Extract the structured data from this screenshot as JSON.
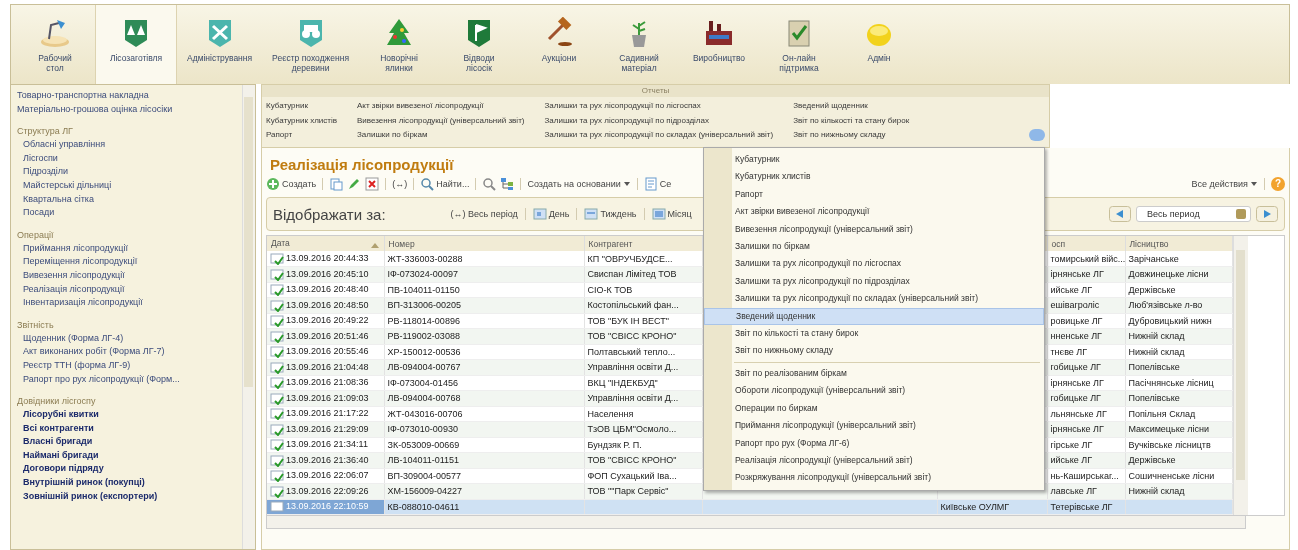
{
  "toolbar": {
    "items": [
      {
        "label": "Рабочий\nстол",
        "selected": false
      },
      {
        "label": "Лісозаготівля",
        "selected": true
      },
      {
        "label": "Адміністрування",
        "selected": false
      },
      {
        "label": "Реєстр походження\nдеревини",
        "selected": false
      },
      {
        "label": "Новорічні\nялинки",
        "selected": false
      },
      {
        "label": "Відводи\nлісосік",
        "selected": false
      },
      {
        "label": "Аукціони",
        "selected": false
      },
      {
        "label": "Садивний\nматеріал",
        "selected": false
      },
      {
        "label": "Виробництво",
        "selected": false
      },
      {
        "label": "Он-лайн\nпідтримка",
        "selected": false
      },
      {
        "label": "Адмін",
        "selected": false
      }
    ]
  },
  "sidebar": {
    "sections": [
      {
        "kind": "links",
        "items": [
          "Товарно-транспортна накладна",
          "Матеріально-грошова оцінка лісосіки"
        ]
      },
      {
        "kind": "links",
        "heading": "Структура ЛГ",
        "items": [
          "Обласні управління",
          "Лісгоспи",
          "Підрозділи",
          "Майстерські дільниці",
          "Квартальна сітка",
          "Посади"
        ]
      },
      {
        "kind": "links",
        "heading": "Операції",
        "items": [
          "Приймання лісопродукції",
          "Переміщення лісопродукції",
          "Вивезення лісопродукції",
          "Реалізація лісопродукції",
          "Інвентаризація лісопродукції"
        ]
      },
      {
        "kind": "links",
        "heading": "Звітність",
        "items": [
          "Щоденник (Форма ЛГ-4)",
          "Акт виконаних робіт (Форма ЛГ-7)",
          "Реєстр ТТН (форма ЛГ-9)",
          "Рапорт про рух лісопродукції (Форм..."
        ]
      },
      {
        "kind": "catalogs",
        "heading": "Довідники лісгоспу",
        "items": [
          "Лісорубні квитки",
          "Всі контрагенти",
          "Власні бригади",
          "Наймані бригади",
          "Договори підряду",
          "Внутрішній ринок (покупці)",
          "Зовнішній ринок (експортери)"
        ]
      }
    ]
  },
  "reports_panel": {
    "title": "Отчеты",
    "menu_open": true,
    "columns": [
      [
        "Кубатурник",
        "Кубатурник хлистів",
        "Рапорт"
      ],
      [
        "Акт звірки вивезеної лісопродукції",
        "Вивезення лісопродукції (універсальний звіт)",
        "Залишки по біркам"
      ],
      [
        "Залишки та рух лісопродукції по лісгоспах",
        "Залишки та рух лісопродукції по підрозділах",
        "Залишки та рух лісопродукції по складах (універсальний звіт)"
      ],
      [
        "Зведений щоденник",
        "Звіт по кількості та стану бирок",
        "Звіт по нижньому складу"
      ]
    ]
  },
  "document": {
    "title": "Реалізація лісопродукції",
    "commands": [
      [
        {
          "kind": "button",
          "label": "Создать"
        }
      ],
      [
        {
          "kind": "icon"
        },
        {
          "kind": "icon"
        },
        {
          "kind": "icon"
        }
      ],
      [
        {
          "kind": "button",
          "label": "(↔)"
        }
      ],
      [
        {
          "kind": "button",
          "label": "Найти..."
        }
      ],
      [
        {
          "kind": "icon"
        },
        {
          "kind": "icon"
        }
      ],
      [
        {
          "kind": "menu",
          "label": "Создать на основании"
        }
      ],
      [
        {
          "kind": "button",
          "label": "Се"
        }
      ]
    ],
    "all_actions": "Все действия",
    "help": "?"
  },
  "period_filter": {
    "label": "Відображати за:",
    "options": [
      {
        "label": "(↔) Весь період"
      },
      {
        "label": "День"
      },
      {
        "label": "Тиждень"
      },
      {
        "label": "Місяц"
      }
    ],
    "period_field": "Весь период"
  },
  "table": {
    "columns": [
      {
        "label": "Дата",
        "sorted": true
      },
      {
        "label": "Номер",
        "sorted": false
      },
      {
        "label": "Контрагент",
        "sorted": false
      },
      {},
      {},
      {
        "label": "осп",
        "sorted": false
      },
      {
        "label": "Лісництво",
        "sorted": false
      }
    ],
    "rows": [
      {
        "posted": true,
        "selected": false,
        "date": "13.09.2016 20:44:33",
        "number": "ЖТ-336003-00288",
        "counterparty": "КП \"ОВРУЧБУДСЕ...",
        "column_6": "томирський війс...",
        "forest_district": "Зарічанське"
      },
      {
        "posted": true,
        "selected": false,
        "date": "13.09.2016 20:45:10",
        "number": "ІФ-073024-00097",
        "counterparty": "Свиспан Лімітед ТОВ",
        "column_6": "ірнянське ЛГ",
        "forest_district": "Довжинецьке лісни"
      },
      {
        "posted": true,
        "selected": false,
        "date": "13.09.2016 20:48:40",
        "number": "ПВ-104011-01150",
        "counterparty": "СІО-К ТОВ",
        "column_6": "ийське ЛГ",
        "forest_district": "Держівське"
      },
      {
        "posted": true,
        "selected": false,
        "date": "13.09.2016 20:48:50",
        "number": "ВП-313006-00205",
        "counterparty": "Костопільський фан...",
        "column_6": "ешівагроліс",
        "forest_district": "Люб'язівське л-во"
      },
      {
        "posted": true,
        "selected": false,
        "date": "13.09.2016 20:49:22",
        "number": "РВ-118014-00896",
        "counterparty": "ТОВ \"БУК ІН ВЕСТ\"",
        "column_6": "ровицьке ЛГ",
        "forest_district": "Дубровицький нижн"
      },
      {
        "posted": true,
        "selected": false,
        "date": "13.09.2016 20:51:46",
        "number": "РВ-119002-03088",
        "counterparty": "ТОВ \"СВІСС КРОНО\"",
        "column_6": "нненське ЛГ",
        "forest_district": "Нижній склад"
      },
      {
        "posted": true,
        "selected": false,
        "date": "13.09.2016 20:55:46",
        "number": "ХР-150012-00536",
        "counterparty": "Полтавський тепло...",
        "column_6": "тнєве ЛГ",
        "forest_district": "Нижній склад"
      },
      {
        "posted": true,
        "selected": false,
        "date": "13.09.2016 21:04:48",
        "number": "ЛВ-094004-00767",
        "counterparty": "Управління освіти Д...",
        "column_6": "гобицьке ЛГ",
        "forest_district": "Попелівське"
      },
      {
        "posted": true,
        "selected": false,
        "date": "13.09.2016 21:08:36",
        "number": "ІФ-073004-01456",
        "counterparty": "ВКЦ \"ІНДЕКБУД\"",
        "column_6": "ірнянське ЛГ",
        "forest_district": "Пасічнянське лісниц"
      },
      {
        "posted": true,
        "selected": false,
        "date": "13.09.2016 21:09:03",
        "number": "ЛВ-094004-00768",
        "counterparty": "Управління освіти Д...",
        "column_6": "гобицьке ЛГ",
        "forest_district": "Попелівське"
      },
      {
        "posted": true,
        "selected": false,
        "date": "13.09.2016 21:17:22",
        "number": "ЖТ-043016-00706",
        "counterparty": "Населення",
        "column_6": "льнянське ЛГ",
        "forest_district": "Попільня Склад"
      },
      {
        "posted": true,
        "selected": false,
        "date": "13.09.2016 21:29:09",
        "number": "ІФ-073010-00930",
        "counterparty": "ТзОВ ЦБМ\"Осмоло...",
        "column_6": "ірнянське ЛГ",
        "forest_district": "Максимецьке лісни"
      },
      {
        "posted": true,
        "selected": false,
        "date": "13.09.2016 21:34:11",
        "number": "ЗК-053009-00669",
        "counterparty": "Бундзяк Р. П.",
        "column_6": "гірське ЛГ",
        "forest_district": "Вучківське лісництв"
      },
      {
        "posted": true,
        "selected": false,
        "date": "13.09.2016 21:36:40",
        "number": "ЛВ-104011-01151",
        "counterparty": "ТОВ \"СВІСС КРОНО\"",
        "column_6": "ийське ЛГ",
        "forest_district": "Держівське"
      },
      {
        "posted": true,
        "selected": false,
        "date": "13.09.2016 22:06:07",
        "number": "ВП-309004-00577",
        "counterparty": "ФОП Сухацький Іва...",
        "column_6": "нь-Каширськаг...",
        "forest_district": "Сошичненське лісни"
      },
      {
        "posted": true,
        "selected": false,
        "date": "13.09.2016 22:09:26",
        "number": "ХМ-156009-04227",
        "counterparty": "ТОВ \"\"Парк Сервіс\"",
        "column_6": "лавське ЛГ",
        "forest_district": "Нижній склад"
      },
      {
        "posted": false,
        "selected": true,
        "date": "13.09.2016 22:10:59",
        "number": "КВ-088010-04611",
        "column_5": "Київське ОУЛМГ",
        "column_6": "Тетерівське ЛГ"
      }
    ]
  },
  "popup_menu": {
    "groups": [
      [
        {
          "label": "Кубатурник",
          "selected": false
        },
        {
          "label": "Кубатурник хлистів",
          "selected": false
        },
        {
          "label": "Рапорт",
          "selected": false
        },
        {
          "label": "Акт звірки вивезеної лісопродукції",
          "selected": false
        },
        {
          "label": "Вивезення лісопродукції (універсальний звіт)",
          "selected": false
        },
        {
          "label": "Залишки по біркам",
          "selected": false
        },
        {
          "label": "Залишки та рух лісопродукції по лісгоспах",
          "selected": false
        },
        {
          "label": "Залишки та рух лісопродукції по підрозділах",
          "selected": false
        },
        {
          "label": "Залишки та рух лісопродукції по складах (універсальний звіт)",
          "selected": false
        },
        {
          "label": "Зведений щоденник",
          "selected": true
        },
        {
          "label": "Звіт по кількості та стану бирок",
          "selected": false
        },
        {
          "label": "Звіт по нижньому складу",
          "selected": false
        }
      ],
      [
        {
          "label": "Звіт по реалізованим біркам",
          "selected": false
        },
        {
          "label": "Обороти лісопродукції (універсальний звіт)",
          "selected": false
        },
        {
          "label": "Операции по биркам",
          "selected": false
        },
        {
          "label": "Приймання лісопродукції (універсальний звіт)",
          "selected": false
        },
        {
          "label": "Рапорт про рух (Форма ЛГ-6)",
          "selected": false
        },
        {
          "label": "Реалізація лісопродукції (універсальний звіт)",
          "selected": false
        },
        {
          "label": "Розкряжування лісопродукції (універсальний звіт)",
          "selected": false
        }
      ]
    ]
  }
}
